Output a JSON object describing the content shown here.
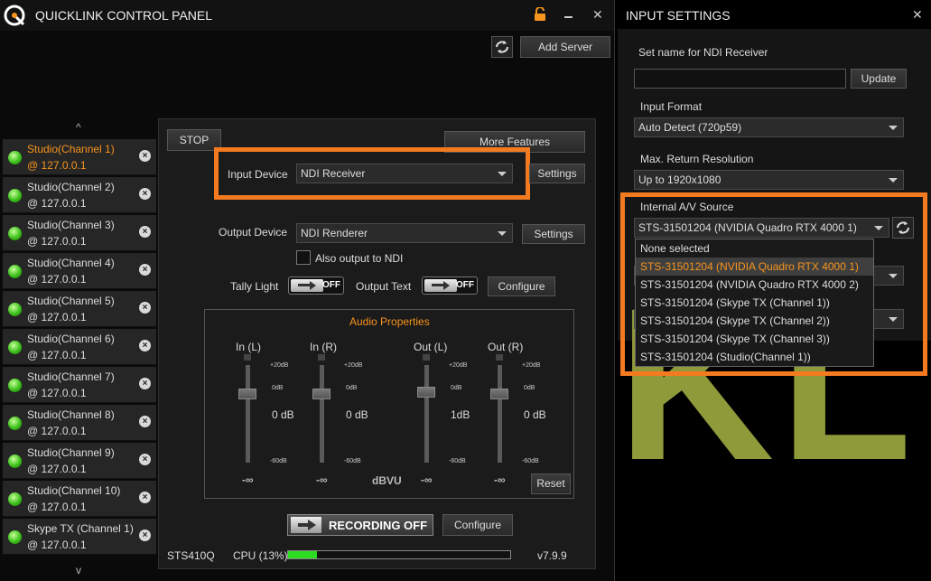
{
  "main_window": {
    "title": "QUICKLINK CONTROL PANEL",
    "add_server_label": "Add Server",
    "scroll_up": "^",
    "scroll_down": "v"
  },
  "servers": [
    {
      "name": "Studio(Channel 1)",
      "ip": "@ 127.0.0.1",
      "active": true
    },
    {
      "name": "Studio(Channel 2)",
      "ip": "@ 127.0.0.1"
    },
    {
      "name": "Studio(Channel 3)",
      "ip": "@ 127.0.0.1"
    },
    {
      "name": "Studio(Channel 4)",
      "ip": "@ 127.0.0.1"
    },
    {
      "name": "Studio(Channel 5)",
      "ip": "@ 127.0.0.1"
    },
    {
      "name": "Studio(Channel 6)",
      "ip": "@ 127.0.0.1"
    },
    {
      "name": "Studio(Channel 7)",
      "ip": "@ 127.0.0.1"
    },
    {
      "name": "Studio(Channel 8)",
      "ip": "@ 127.0.0.1"
    },
    {
      "name": "Studio(Channel 9)",
      "ip": "@ 127.0.0.1"
    },
    {
      "name": "Studio(Channel 10)",
      "ip": "@ 127.0.0.1"
    },
    {
      "name": "Skype TX (Channel 1)",
      "ip": "@ 127.0.0.1"
    }
  ],
  "remove_glyph": "×",
  "channel": {
    "stop_label": "STOP",
    "more_features_label": "More Features",
    "input_device_label": "Input Device",
    "input_device_value": "NDI Receiver",
    "settings_label": "Settings",
    "output_device_label": "Output Device",
    "output_device_value": "NDI Renderer",
    "also_output_label": "Also output to NDI",
    "tally_light_label": "Tally Light",
    "output_text_label": "Output Text",
    "toggle_off": "OFF",
    "configure_label": "Configure",
    "recording_label": "RECORDING OFF",
    "device_name": "STS410Q",
    "cpu_label": "CPU (13%)",
    "cpu_percent": 13,
    "version": "v7.9.9"
  },
  "audio": {
    "title": "Audio Properties",
    "channels": [
      {
        "label": "In (L)",
        "value": "0 dB",
        "bottom": "-∞",
        "level": 0
      },
      {
        "label": "In (R)",
        "value": "0 dB",
        "bottom": "-∞",
        "level": 0
      },
      {
        "label": "Out (L)",
        "value": "1dB",
        "bottom": "-∞",
        "level": 1
      },
      {
        "label": "Out (R)",
        "value": "0 dB",
        "bottom": "-∞",
        "level": 0
      }
    ],
    "scale_top": "+20dB",
    "scale_mid": "0dB",
    "scale_bottom": "-60dB",
    "unit_label": "dBVU",
    "reset_label": "Reset"
  },
  "input_settings": {
    "title": "INPUT SETTINGS",
    "ndi_name_label": "Set name for NDI Receiver",
    "ndi_name_value": "",
    "update_label": "Update",
    "input_format_label": "Input Format",
    "input_format_value": "Auto Detect (720p59)",
    "max_return_label": "Max. Return Resolution",
    "max_return_value": "Up to 1920x1080",
    "av_source_label": "Internal A/V Source",
    "av_source_value": "STS-31501204 (NVIDIA Quadro RTX 4000 1)",
    "dropdown_items": [
      "None selected",
      "STS-31501204 (NVIDIA Quadro RTX 4000 1)",
      "STS-31501204 (NVIDIA Quadro RTX 4000 2)",
      "STS-31501204 (Skype TX (Channel 1))",
      "STS-31501204 (Skype TX (Channel 2))",
      "STS-31501204 (Skype TX (Channel 3))",
      "STS-31501204 (Studio(Channel 1))"
    ],
    "selected_index": 1,
    "background_text": "KLIN"
  },
  "colors": {
    "accent": "#f7941d",
    "highlight_border": "#f47a20",
    "led_green": "#3bc01a",
    "brand_olive": "#8f9a3a"
  },
  "icons": [
    "lock-icon",
    "minimize-icon",
    "close-icon",
    "refresh-icon",
    "logo-icon"
  ]
}
